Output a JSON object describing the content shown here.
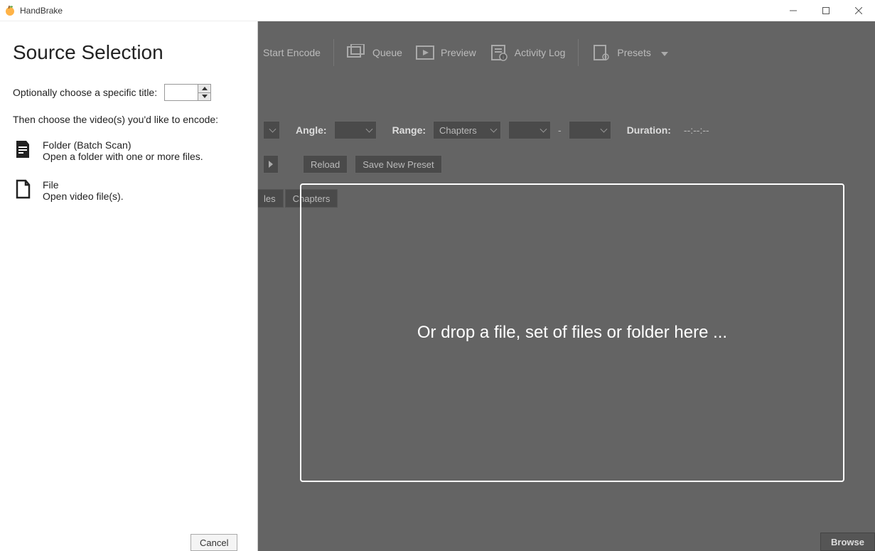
{
  "window": {
    "title": "HandBrake"
  },
  "toolbar": {
    "start_encode": "Start Encode",
    "queue": "Queue",
    "preview": "Preview",
    "activity_log": "Activity Log",
    "presets": "Presets"
  },
  "controls": {
    "angle_label": "Angle:",
    "range_label": "Range:",
    "range_value": "Chapters",
    "dash": "-",
    "duration_label": "Duration:",
    "duration_value": "--:--:--",
    "reload": "Reload",
    "save_new_preset": "Save New Preset"
  },
  "tabs": {
    "t1": "les",
    "t2": "Chapters"
  },
  "dropzone": {
    "message": "Or drop a file, set of files or folder here ..."
  },
  "browse": "Browse",
  "source_panel": {
    "heading": "Source Selection",
    "title_opt_label": "Optionally choose a specific title:",
    "instruction": "Then choose the video(s) you'd like to encode:",
    "folder": {
      "title": "Folder (Batch Scan)",
      "desc": "Open a folder with one or more files."
    },
    "file": {
      "title": "File",
      "desc": "Open video file(s)."
    },
    "cancel": "Cancel"
  }
}
